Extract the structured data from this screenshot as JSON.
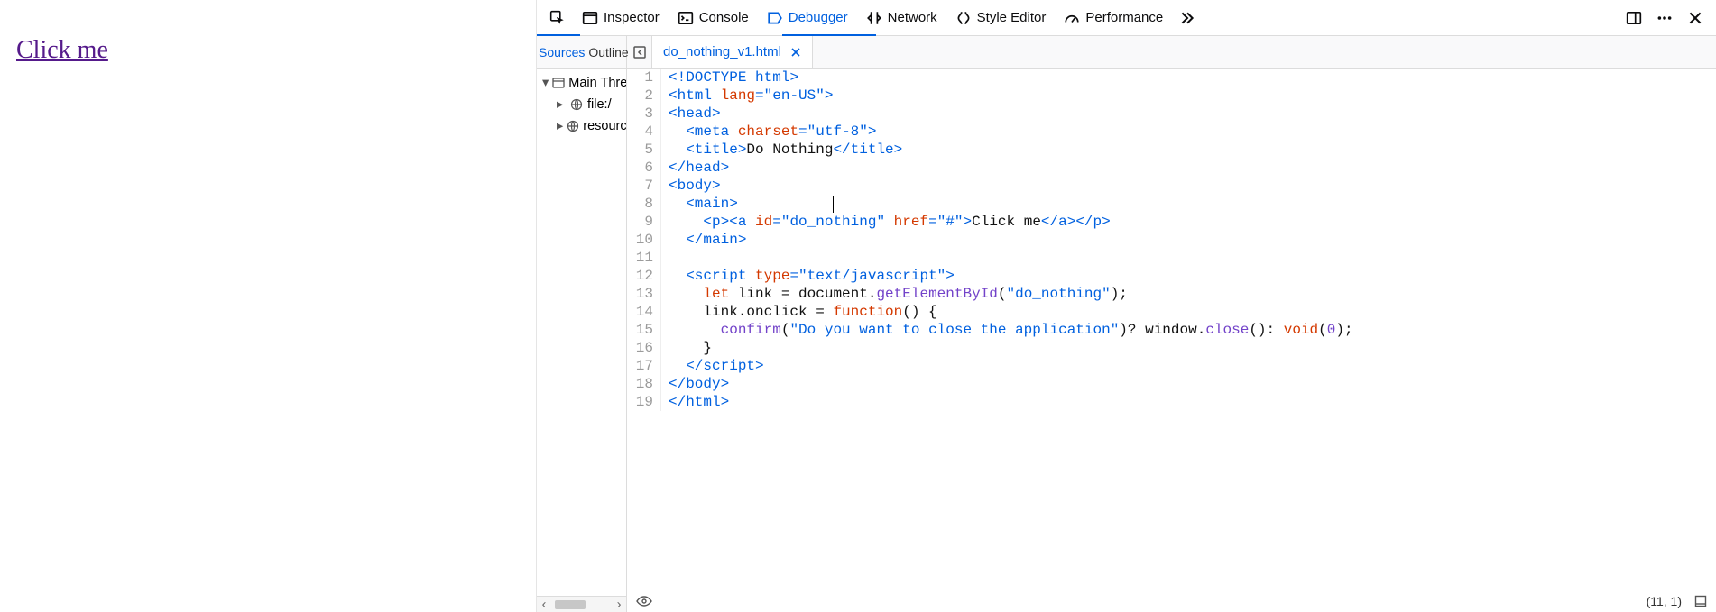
{
  "page": {
    "link_text": "Click me"
  },
  "toolbar": {
    "inspector": "Inspector",
    "console": "Console",
    "debugger": "Debugger",
    "network": "Network",
    "style_editor": "Style Editor",
    "performance": "Performance"
  },
  "sidebar": {
    "sources_label": "Sources",
    "outline_label": "Outline"
  },
  "tabs": {
    "file_name": "do_nothing_v1.html"
  },
  "tree": {
    "main": "Main Thread",
    "file": "file:/",
    "resource": "resource"
  },
  "cursor_pos": "(11, 1)",
  "code_lines": [
    {
      "n": 1,
      "segs": [
        [
          "tag",
          "<!DOCTYPE"
        ],
        [
          "plain",
          " "
        ],
        [
          "tag",
          "html>"
        ]
      ]
    },
    {
      "n": 2,
      "segs": [
        [
          "tag",
          "<html"
        ],
        [
          "plain",
          " "
        ],
        [
          "attr",
          "lang"
        ],
        [
          "tag",
          "="
        ],
        [
          "str",
          "\"en-US\""
        ],
        [
          "tag",
          ">"
        ]
      ]
    },
    {
      "n": 3,
      "segs": [
        [
          "tag",
          "<head>"
        ]
      ]
    },
    {
      "n": 4,
      "segs": [
        [
          "plain",
          "  "
        ],
        [
          "tag",
          "<meta"
        ],
        [
          "plain",
          " "
        ],
        [
          "attr",
          "charset"
        ],
        [
          "tag",
          "="
        ],
        [
          "str",
          "\"utf-8\""
        ],
        [
          "tag",
          ">"
        ]
      ]
    },
    {
      "n": 5,
      "segs": [
        [
          "plain",
          "  "
        ],
        [
          "tag",
          "<title>"
        ],
        [
          "plain",
          "Do Nothing"
        ],
        [
          "tag",
          "</title>"
        ]
      ]
    },
    {
      "n": 6,
      "segs": [
        [
          "tag",
          "</head>"
        ]
      ]
    },
    {
      "n": 7,
      "segs": [
        [
          "tag",
          "<body>"
        ]
      ]
    },
    {
      "n": 8,
      "segs": [
        [
          "plain",
          "  "
        ],
        [
          "tag",
          "<main>"
        ]
      ]
    },
    {
      "n": 9,
      "segs": [
        [
          "plain",
          "    "
        ],
        [
          "tag",
          "<p><a"
        ],
        [
          "plain",
          " "
        ],
        [
          "attr",
          "id"
        ],
        [
          "tag",
          "="
        ],
        [
          "str",
          "\"do_nothing\""
        ],
        [
          "plain",
          " "
        ],
        [
          "attr",
          "href"
        ],
        [
          "tag",
          "="
        ],
        [
          "str",
          "\"#\""
        ],
        [
          "tag",
          ">"
        ],
        [
          "plain",
          "Click me"
        ],
        [
          "tag",
          "</a></p>"
        ]
      ]
    },
    {
      "n": 10,
      "segs": [
        [
          "plain",
          "  "
        ],
        [
          "tag",
          "</main>"
        ]
      ]
    },
    {
      "n": 11,
      "segs": [
        [
          "plain",
          ""
        ]
      ]
    },
    {
      "n": 12,
      "segs": [
        [
          "plain",
          "  "
        ],
        [
          "tag",
          "<script"
        ],
        [
          "plain",
          " "
        ],
        [
          "attr",
          "type"
        ],
        [
          "tag",
          "="
        ],
        [
          "str",
          "\"text/javascript\""
        ],
        [
          "tag",
          ">"
        ]
      ]
    },
    {
      "n": 13,
      "segs": [
        [
          "plain",
          "    "
        ],
        [
          "kw",
          "let"
        ],
        [
          "plain",
          " "
        ],
        [
          "plain",
          "link = document."
        ],
        [
          "func",
          "getElementById"
        ],
        [
          "plain",
          "("
        ],
        [
          "str",
          "\"do_nothing\""
        ],
        [
          "plain",
          ");"
        ]
      ]
    },
    {
      "n": 14,
      "segs": [
        [
          "plain",
          "    link.onclick = "
        ],
        [
          "kw",
          "function"
        ],
        [
          "plain",
          "() {"
        ]
      ]
    },
    {
      "n": 15,
      "segs": [
        [
          "plain",
          "      "
        ],
        [
          "func",
          "confirm"
        ],
        [
          "plain",
          "("
        ],
        [
          "str",
          "\"Do you want to close the application\""
        ],
        [
          "plain",
          ")? window."
        ],
        [
          "func",
          "close"
        ],
        [
          "plain",
          "(): "
        ],
        [
          "kw",
          "void"
        ],
        [
          "plain",
          "("
        ],
        [
          "num",
          "0"
        ],
        [
          "plain",
          ");"
        ]
      ]
    },
    {
      "n": 16,
      "segs": [
        [
          "plain",
          "    }"
        ]
      ]
    },
    {
      "n": 17,
      "segs": [
        [
          "plain",
          "  "
        ],
        [
          "tag",
          "</script>"
        ]
      ]
    },
    {
      "n": 18,
      "segs": [
        [
          "tag",
          "</body>"
        ]
      ]
    },
    {
      "n": 19,
      "segs": [
        [
          "tag",
          "</html>"
        ]
      ]
    }
  ]
}
